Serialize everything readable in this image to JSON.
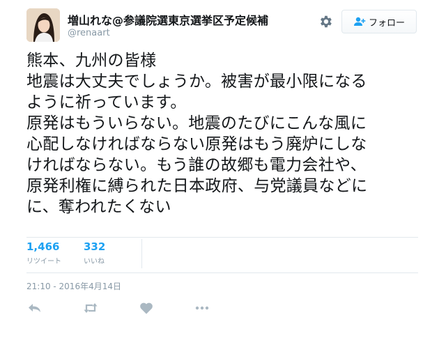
{
  "tweet": {
    "display_name": "増山れな@参議院選東京選挙区予定候補",
    "handle": "@renaart",
    "follow_label": "フォロー",
    "text_lines": [
      "熊本、九州の皆様",
      "地震は大丈夫でしょうか。被害が最小限になる",
      "ように祈っています。",
      "原発はもういらない。地震のたびにこんな風に",
      "心配しなければならない原発はもう廃炉にしな",
      "ければならない。もう誰の故郷も電力会社や、",
      "原発利権に縛られた日本政府、与党議員などに",
      "に、奪われたくない"
    ],
    "retweets": {
      "count": "1,466",
      "label": "リツイート"
    },
    "likes": {
      "count": "332",
      "label": "いいね"
    },
    "timestamp": "21:10 - 2016年4月14日"
  },
  "icons": {
    "gear": "gear-icon",
    "follow": "add-user-icon",
    "reply": "reply-icon",
    "retweet": "retweet-icon",
    "like": "heart-icon",
    "more": "more-dots-icon"
  },
  "colors": {
    "accent": "#1da1f2",
    "muted": "#8899a6",
    "icon": "#aab8c2",
    "border": "#e1e8ed"
  }
}
